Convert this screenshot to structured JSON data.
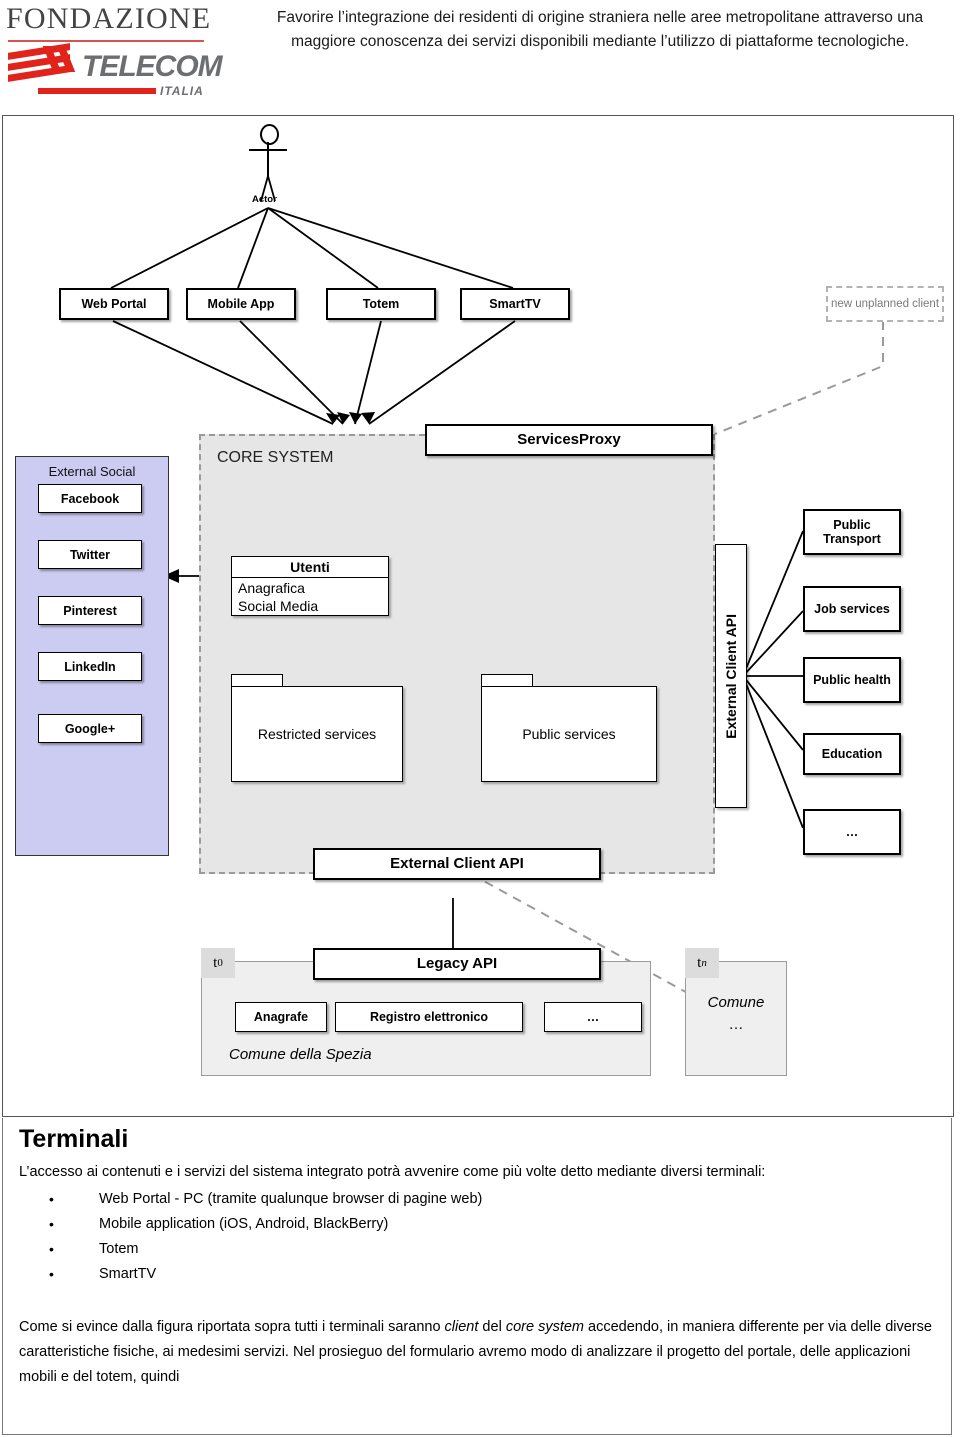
{
  "header": {
    "brand_top": "FONDAZIONE",
    "brand_main": "TELECOM",
    "brand_sub": "ITALIA",
    "title": "Favorire l’integrazione dei residenti di origine straniera nelle aree metropolitane attraverso una maggiore conoscenza dei servizi disponibili mediante l’utilizzo di piattaforme tecnologiche."
  },
  "diagram": {
    "actor_label": "Actor",
    "clients": [
      {
        "label": "Web Portal"
      },
      {
        "label": "Mobile App"
      },
      {
        "label": "Totem"
      },
      {
        "label": "SmartTV"
      }
    ],
    "unplanned_client": "new unplanned client",
    "core_system_title": "CORE SYSTEM",
    "services_proxy": "ServicesProxy",
    "external_social": {
      "title": "External Social",
      "items": [
        "Facebook",
        "Twitter",
        "Pinterest",
        "LinkedIn",
        "Google+"
      ]
    },
    "utenti": {
      "title": "Utenti",
      "lines": [
        "Anagrafica",
        "Social Media"
      ]
    },
    "packages": [
      {
        "label": "Restricted services"
      },
      {
        "label": "Public services"
      }
    ],
    "external_client_api_vertical": "External Client API",
    "external_services": [
      {
        "label": "Public Transport"
      },
      {
        "label": "Job services"
      },
      {
        "label": "Public health"
      },
      {
        "label": "Education"
      },
      {
        "label": "…"
      }
    ],
    "external_client_api_bottom": "External Client API",
    "legacy": {
      "t0_label": "t",
      "t0_sub": "0",
      "tn_label": "t",
      "tn_sub": "n",
      "legacy_api": "Legacy API",
      "modules": [
        "Anagrafe",
        "Registro elettronico",
        "…"
      ],
      "comune_spezia": "Comune della Spezia",
      "comune": "Comune",
      "comune_dots": "…"
    }
  },
  "content": {
    "heading": "Terminali",
    "intro": "L’accesso ai contenuti e i servizi del sistema integrato potrà avvenire come più volte detto mediante diversi terminali:",
    "bullets": [
      "Web Portal - PC (tramite qualunque browser di pagine web)",
      "Mobile application (iOS, Android, BlackBerry)",
      "Totem",
      "SmartTV"
    ],
    "closing_1": "Come si evince dalla figura riportata sopra tutti i terminali saranno ",
    "closing_em1": "client",
    "closing_2": " del ",
    "closing_em2": "core system",
    "closing_3": " accedendo, in maniera differente per via delle diverse caratteristiche fisiche, ai medesimi servizi. Nel prosieguo del formulario avremo modo di analizzare il progetto del portale, delle applicazioni mobili e del totem, quindi"
  },
  "colors": {
    "accent_red": "#e1231b",
    "logo_grey": "#6d6e71",
    "core_fill": "#e6e6e6",
    "social_fill": "#ccccf2"
  }
}
